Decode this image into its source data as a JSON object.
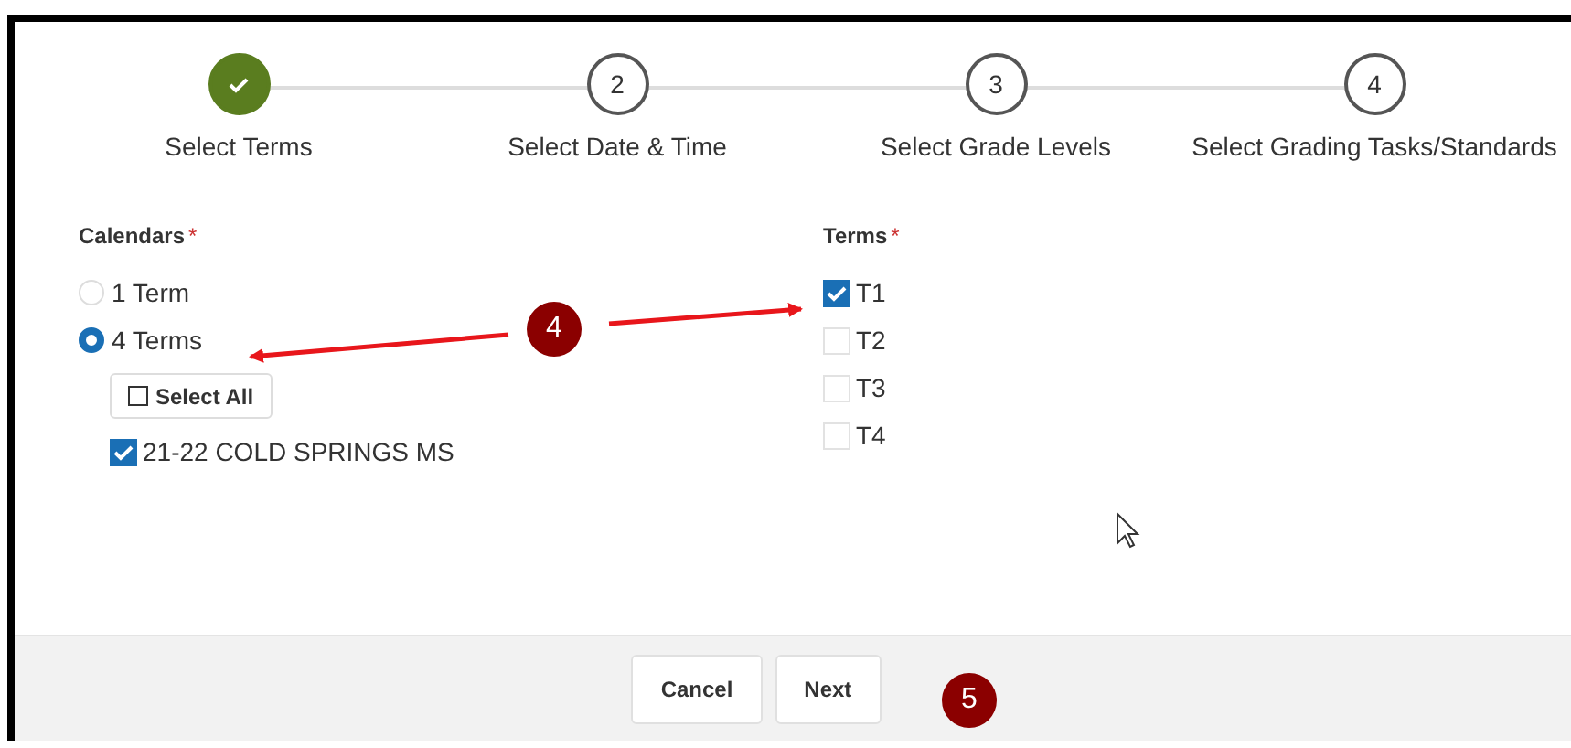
{
  "steps": [
    {
      "label": "Select Terms",
      "completed": true
    },
    {
      "number": "2",
      "label": "Select Date & Time",
      "completed": false
    },
    {
      "number": "3",
      "label": "Select Grade Levels",
      "completed": false
    },
    {
      "number": "4",
      "label": "Select Grading Tasks/Standards",
      "completed": false
    }
  ],
  "calendars": {
    "label": "Calendars",
    "required": "*",
    "options": [
      {
        "label": "1 Term",
        "selected": false
      },
      {
        "label": "4 Terms",
        "selected": true
      }
    ],
    "select_all": "Select All",
    "items": [
      {
        "label": "21-22 COLD SPRINGS MS",
        "checked": true
      }
    ]
  },
  "terms": {
    "label": "Terms",
    "required": "*",
    "items": [
      {
        "label": "T1",
        "checked": true
      },
      {
        "label": "T2",
        "checked": false
      },
      {
        "label": "T3",
        "checked": false
      },
      {
        "label": "T4",
        "checked": false
      }
    ]
  },
  "buttons": [
    "Cancel",
    "Next"
  ],
  "annotations": [
    {
      "text": "4"
    },
    {
      "text": "5"
    }
  ]
}
